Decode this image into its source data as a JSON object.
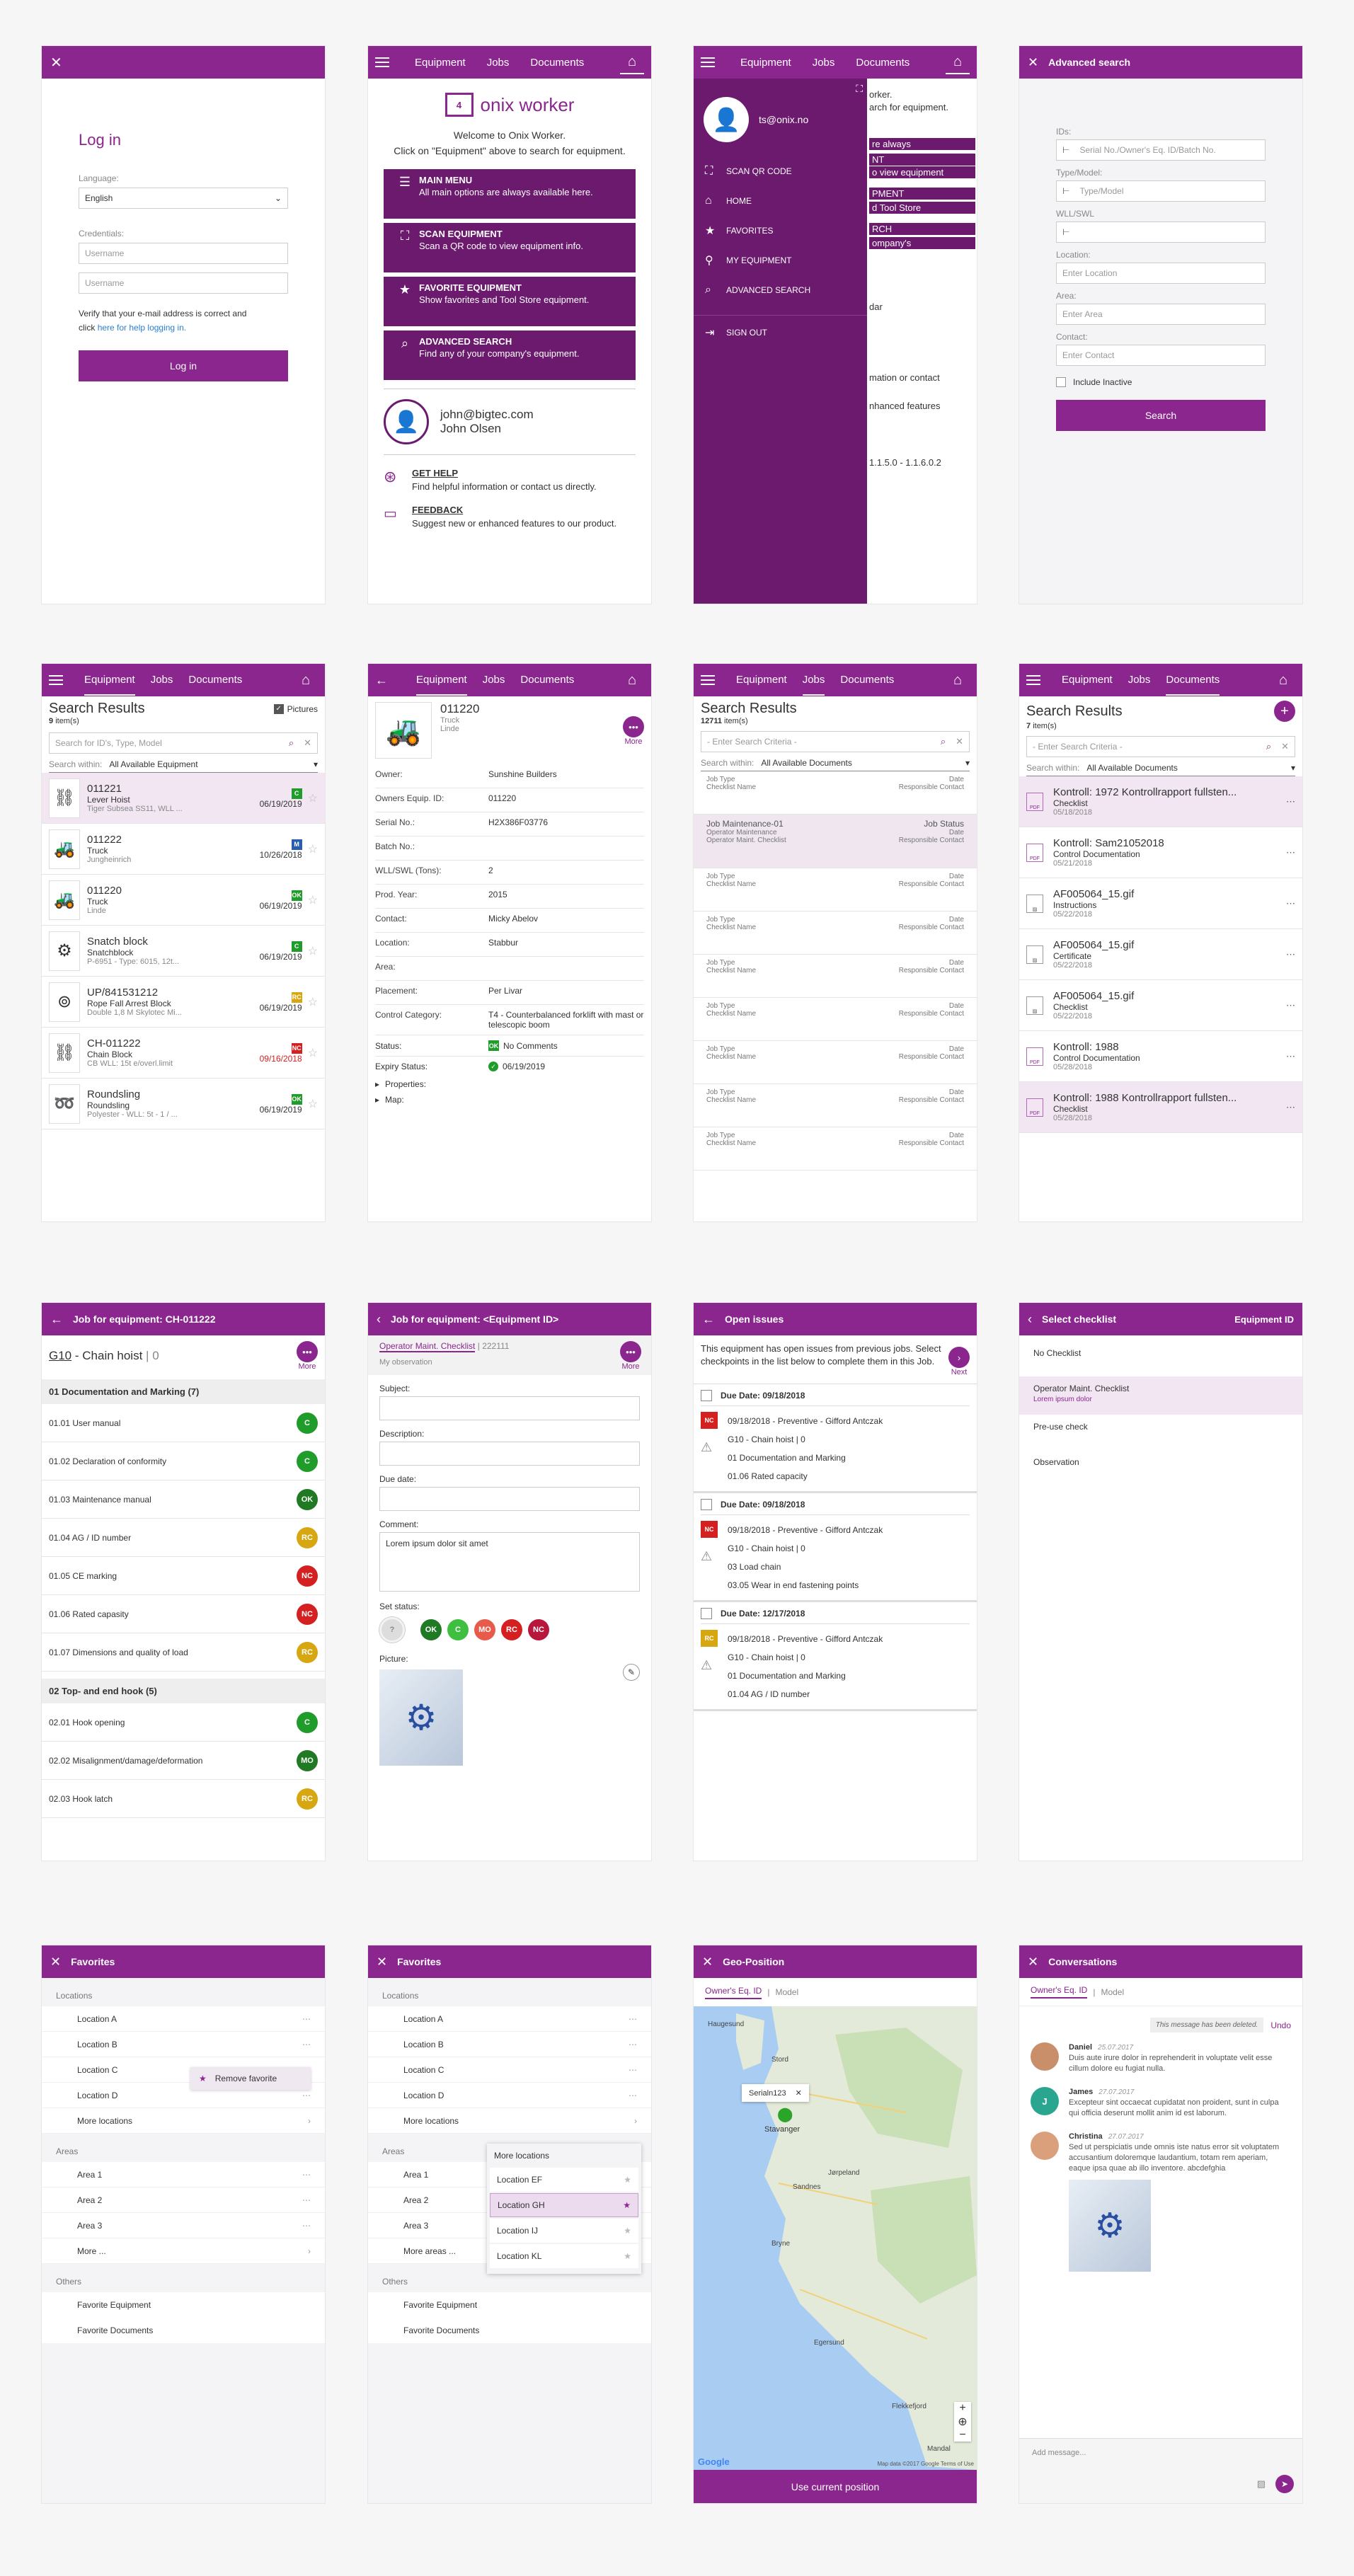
{
  "colors": {
    "brand": "#8a268e",
    "ok": "#1f9c2a",
    "warn": "#d7a712",
    "bad": "#d42020"
  },
  "s1": {
    "title": "Log in",
    "language_label": "Language:",
    "language_value": "English",
    "credentials_label": "Credentials:",
    "username_ph": "Username",
    "password_ph": "Username",
    "note_a": "Verify that your e-mail address is correct and",
    "note_b": "click",
    "note_link": "here for help logging in.",
    "login_btn": "Log in"
  },
  "nav": {
    "equipment": "Equipment",
    "jobs": "Jobs",
    "documents": "Documents"
  },
  "s2": {
    "logo": "onix worker",
    "welcome": "Welcome to Onix Worker.",
    "hint": "Click on \"Equipment\" above to search for equipment.",
    "menu": [
      {
        "title": "MAIN MENU",
        "desc": "All main options are always available here."
      },
      {
        "title": "SCAN EQUIPMENT",
        "desc": "Scan a QR code to view equipment info."
      },
      {
        "title": "FAVORITE EQUIPMENT",
        "desc": "Show favorites and Tool Store equipment."
      },
      {
        "title": "ADVANCED SEARCH",
        "desc": "Find any of your company's equipment."
      }
    ],
    "email": "john@bigtec.com",
    "name": "John Olsen",
    "help_title": "GET HELP",
    "help_desc": "Find helpful information or contact us directly.",
    "feedback_title": "FEEDBACK",
    "feedback_desc": "Suggest new or enhanced features to our product."
  },
  "s3": {
    "email": "ts@onix.no",
    "items": [
      "SCAN QR CODE",
      "HOME",
      "FAVORITES",
      "MY EQUIPMENT",
      "ADVANCED SEARCH",
      "SIGN OUT"
    ],
    "bg_texts": [
      "orker.",
      "arch for equipment.",
      "re always",
      "NT",
      "o view equipment",
      "PMENT",
      "d Tool Store",
      "RCH",
      "ompany's",
      "dar",
      "mation or contact",
      "nhanced features",
      "1.1.5.0 - 1.1.6.0.2"
    ]
  },
  "s4": {
    "title": "Advanced search",
    "ids_label": "IDs:",
    "ids_ph": "Serial No./Owner's Eq. ID/Batch No.",
    "type_label": "Type/Model:",
    "type_ph": "Type/Model",
    "wll_label": "WLL/SWL",
    "loc_label": "Location:",
    "loc_ph": "Enter Location",
    "area_label": "Area:",
    "area_ph": "Enter Area",
    "contact_label": "Contact:",
    "contact_ph": "Enter Contact",
    "inactive": "Include Inactive",
    "search_btn": "Search"
  },
  "s5": {
    "title": "Search Results",
    "count": "9",
    "items_word": "item(s)",
    "pictures": "Pictures",
    "search_ph": "Search for ID's, Type, Model",
    "within_label": "Search within:",
    "within_value": "All Available Equipment",
    "rows": [
      {
        "id": "011221",
        "type": "Lever Hoist",
        "sub": "Tiger Subsea SS11, WLL ...",
        "badge": "C",
        "date": "06/19/2019",
        "red": false,
        "color": "#1f9c2a"
      },
      {
        "id": "011222",
        "type": "Truck",
        "sub": "Jungheinrich",
        "badge": "M",
        "date": "10/26/2018",
        "red": false,
        "color": "#2a5db0"
      },
      {
        "id": "011220",
        "type": "Truck",
        "sub": "Linde",
        "badge": "OK",
        "date": "06/19/2019",
        "red": false,
        "color": "#1f9c2a"
      },
      {
        "id": "Snatch block",
        "type": "Snatchblock",
        "sub": "P-6951 - Type: 6015, 12t...",
        "badge": "C",
        "date": "06/19/2019",
        "red": false,
        "color": "#1f9c2a"
      },
      {
        "id": "UP/841531212",
        "type": "Rope Fall Arrest Block",
        "sub": "Double 1,8 M Skylotec Mi...",
        "badge": "RC",
        "date": "06/19/2019",
        "red": false,
        "color": "#d7a712"
      },
      {
        "id": "CH-011222",
        "type": "Chain Block",
        "sub": "CB WLL: 15t e/overl.limit",
        "badge": "NC",
        "date": "09/16/2018",
        "red": true,
        "color": "#d42020"
      },
      {
        "id": "Roundsling",
        "type": "Roundsling",
        "sub": "Polyester - WLL: 5t - 1 / ...",
        "badge": "OK",
        "date": "06/19/2019",
        "red": false,
        "color": "#1f9c2a"
      }
    ]
  },
  "s6": {
    "id": "011220",
    "type": "Truck",
    "make": "Linde",
    "more": "More",
    "fields": [
      [
        "Owner:",
        "Sunshine Builders"
      ],
      [
        "Owners Equip. ID:",
        "011220"
      ],
      [
        "Serial No.:",
        "H2X386F03776"
      ],
      [
        "Batch No.:",
        ""
      ],
      [
        "WLL/SWL (Tons):",
        "2"
      ],
      [
        "Prod. Year:",
        "2015"
      ],
      [
        "Contact:",
        "Micky Abelov"
      ],
      [
        "Location:",
        "Stabbur"
      ],
      [
        "Area:",
        ""
      ],
      [
        "Placement:",
        "Per Livar"
      ],
      [
        "Control Category:",
        "T4 - Counterbalanced forklift with mast or telescopic boom"
      ]
    ],
    "status_label": "Status:",
    "status_value": "No Comments",
    "status_badge": "OK",
    "expiry_label": "Expiry Status:",
    "expiry_value": "06/19/2019",
    "properties": "Properties:",
    "map": "Map:"
  },
  "s7": {
    "title": "Search Results",
    "count": "12711",
    "items_word": "item(s)",
    "search_ph": "- Enter Search Criteria -",
    "within_label": "Search within:",
    "within_value": "All Available Documents",
    "rows": [
      {
        "a": "Job Type",
        "b": "Date",
        "c": "Checklist Name",
        "d": "Responsible Contact",
        "hl": false
      },
      {
        "a": "Job Maintenance-01",
        "b": "Job Status",
        "c": "Operator Maintenance",
        "d": "Date",
        "e": "Operator Maint. Checklist",
        "f": "Responsible Contact",
        "hl": true
      },
      {
        "a": "Job Type",
        "b": "Date",
        "c": "Checklist Name",
        "d": "Responsible Contact",
        "hl": false
      },
      {
        "a": "Job Type",
        "b": "Date",
        "c": "Checklist Name",
        "d": "Responsible Contact",
        "hl": false
      },
      {
        "a": "Job Type",
        "b": "Date",
        "c": "Checklist Name",
        "d": "Responsible Contact",
        "hl": false
      },
      {
        "a": "Job Type",
        "b": "Date",
        "c": "Checklist Name",
        "d": "Responsible Contact",
        "hl": false
      },
      {
        "a": "Job Type",
        "b": "Date",
        "c": "Checklist Name",
        "d": "Responsible Contact",
        "hl": false
      },
      {
        "a": "Job Type",
        "b": "Date",
        "c": "Checklist Name",
        "d": "Responsible Contact",
        "hl": false
      },
      {
        "a": "Job Type",
        "b": "Date",
        "c": "Checklist Name",
        "d": "Responsible Contact",
        "hl": false
      }
    ]
  },
  "s8": {
    "title": "Search Results",
    "count": "7",
    "items_word": "item(s)",
    "search_ph": "- Enter Search Criteria -",
    "within_label": "Search within:",
    "within_value": "All Available Documents",
    "rows": [
      {
        "icon": "PDF",
        "name": "Kontroll: 1972 Kontrollrapport fullsten...",
        "type": "Checklist",
        "date": "05/18/2018",
        "hl": true
      },
      {
        "icon": "PDF",
        "name": "Kontroll: Sam21052018",
        "type": "Control Documentation",
        "date": "05/21/2018",
        "hl": false
      },
      {
        "icon": "IMG",
        "name": "AF005064_15.gif",
        "type": "Instructions",
        "date": "05/22/2018",
        "hl": false
      },
      {
        "icon": "IMG",
        "name": "AF005064_15.gif",
        "type": "Certificate",
        "date": "05/22/2018",
        "hl": false
      },
      {
        "icon": "IMG",
        "name": "AF005064_15.gif",
        "type": "Checklist",
        "date": "05/22/2018",
        "hl": false
      },
      {
        "icon": "PDF",
        "name": "Kontroll: 1988",
        "type": "Control Documentation",
        "date": "05/28/2018",
        "hl": false
      },
      {
        "icon": "PDF",
        "name": "Kontroll: 1988 Kontrollrapport fullsten...",
        "type": "Checklist",
        "date": "05/28/2018",
        "hl": true
      }
    ]
  },
  "s9": {
    "title": "Job for equipment: CH-011222",
    "eq_id": "G10",
    "eq_name": "- Chain hoist",
    "eq_num": "0",
    "more": "More",
    "rows": [
      {
        "t": "01 Documentation and Marking (7)",
        "h": true
      },
      {
        "t": "01.01 User manual",
        "b": "C"
      },
      {
        "t": "01.02 Declaration of conformity",
        "b": "C"
      },
      {
        "t": "01.03 Maintenance manual",
        "b": "OK"
      },
      {
        "t": "01.04 AG / ID number",
        "b": "RC"
      },
      {
        "t": "01.05 CE marking",
        "b": "NC"
      },
      {
        "t": "01.06 Rated capasity",
        "b": "NC"
      },
      {
        "t": "01.07 Dimensions and quality of load",
        "b": "RC"
      },
      {
        "t": "02 Top- and end hook (5)",
        "h": true
      },
      {
        "t": "02.01 Hook opening",
        "b": "C"
      },
      {
        "t": "02.02 Misalignment/damage/deformation",
        "b": "MO"
      },
      {
        "t": "02.03 Hook latch",
        "b": "RC"
      }
    ]
  },
  "s10": {
    "title": "Job for equipment: <Equipment ID>",
    "checklist": "Operator Maint. Checklist",
    "code": "222111",
    "sub": "My observation",
    "more": "More",
    "subject": "Subject:",
    "description": "Description:",
    "due": "Due date:",
    "comment": "Comment:",
    "comment_value": "Lorem ipsum dolor sit amet",
    "set_status": "Set status:",
    "statuses": [
      "?",
      "OK",
      "C",
      "MO",
      "RC",
      "NC"
    ],
    "picture": "Picture:"
  },
  "s11": {
    "title": "Open issues",
    "text": "This equipment has open issues from previous jobs. Select checkpoints in the list below to complete them in this Job.",
    "next": "Next",
    "issues": [
      {
        "due": "Due Date: 09/18/2018",
        "badge": "NC",
        "l1": "09/18/2018 - Preventive - Gifford Antczak",
        "l2": "G10 - Chain hoist | 0",
        "l3": "01 Documentation and Marking",
        "l4": "01.06 Rated capacity",
        "color": "#d42020"
      },
      {
        "due": "Due Date: 09/18/2018",
        "badge": "NC",
        "l1": "09/18/2018 - Preventive - Gifford Antczak",
        "l2": "G10 - Chain hoist | 0",
        "l3": "03 Load chain",
        "l4": "03.05 Wear in end fastening points",
        "color": "#d42020"
      },
      {
        "due": "Due Date: 12/17/2018",
        "badge": "RC",
        "l1": "09/18/2018 - Preventive - Gifford Antczak",
        "l2": "G10 - Chain hoist | 0",
        "l3": "01 Documentation and Marking",
        "l4": "01.04 AG / ID number",
        "color": "#d7a712"
      }
    ]
  },
  "s12": {
    "title": "Select checklist",
    "eq": "Equipment ID",
    "items": [
      {
        "t": "No Checklist",
        "s": ""
      },
      {
        "t": "Operator Maint. Checklist",
        "s": "Lorem ipsum dolor",
        "hl": true
      },
      {
        "t": "Pre-use check",
        "s": ""
      },
      {
        "t": "Observation",
        "s": ""
      }
    ]
  },
  "s13": {
    "title": "Favorites",
    "locations": "Locations",
    "loc": [
      "Location A",
      "Location B",
      "Location C",
      "Location D"
    ],
    "more_loc": "More locations",
    "remove": "Remove favorite",
    "areas": "Areas",
    "area": [
      "Area 1",
      "Area 2",
      "Area 3"
    ],
    "more_area": "More ...",
    "others": "Others",
    "other": [
      "Favorite Equipment",
      "Favorite Documents"
    ]
  },
  "s14": {
    "title": "Favorites",
    "locations": "Locations",
    "loc": [
      "Location A",
      "Location B",
      "Location C",
      "Location D"
    ],
    "more_loc": "More locations",
    "areas": "Areas",
    "area": [
      "Area 1",
      "Area 2",
      "Area 3"
    ],
    "more_area": "More areas ...",
    "others": "Others",
    "other": [
      "Favorite Equipment",
      "Favorite Documents"
    ],
    "popup_title": "More locations",
    "popup": [
      "Location EF",
      "Location GH",
      "Location IJ",
      "Location KL"
    ]
  },
  "s15": {
    "title": "Geo-Position",
    "tab1": "Owner's Eq. ID",
    "tab2": "Model",
    "pin": "Serialn123",
    "place": "Stavanger",
    "btn": "Use current position",
    "copy": "Map data ©2017 Google",
    "terms": "Terms of Use",
    "google": "Google",
    "map_labels": [
      "Haugesund",
      "Stord",
      "Jørpeland",
      "Sandnes",
      "Bryne",
      "Egersund",
      "Flekkefjord",
      "Mandal"
    ]
  },
  "s16": {
    "title": "Conversations",
    "tab1": "Owner's Eq. ID",
    "tab2": "Model",
    "deleted": "This message has been deleted.",
    "undo": "Undo",
    "msgs": [
      {
        "n": "Daniel",
        "d": "25.07.2017",
        "t": "Duis aute irure dolor in reprehenderit in voluptate velit esse cillum dolore eu fugiat nulla."
      },
      {
        "n": "James",
        "d": "27.07.2017",
        "t": "Excepteur sint occaecat cupidatat non proident, sunt in culpa qui officia deserunt mollit anim id est laborum."
      },
      {
        "n": "Christina",
        "d": "27.07.2017",
        "t": "Sed ut perspiciatis unde omnis iste natus error sit voluptatem accusantium doloremque laudantium, totam rem aperiam, eaque ipsa quae ab illo inventore. abcdefghia"
      }
    ],
    "add": "Add message..."
  }
}
